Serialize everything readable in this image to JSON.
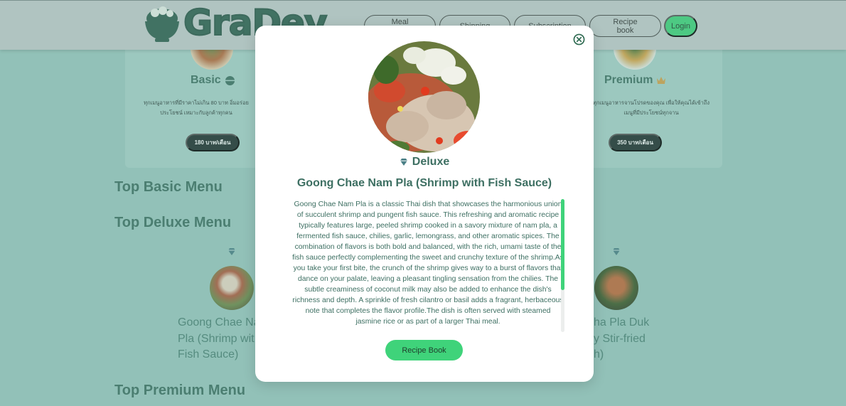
{
  "header": {
    "logo_text": "GraDey",
    "nav": [
      "Meal preparation",
      "Shipping",
      "Subscription",
      "Recipe book"
    ],
    "login_label": "Login"
  },
  "plans": {
    "basic": {
      "title": "Basic",
      "icon": "bowl-icon",
      "desc_line1": "ทุกเมนูอาหารที่มีราคาไม่เกิน 80 บาท อิ่มอร่อย",
      "desc_line2": "ประโยชน์ เหมาะกับลูกค้าทุกคน",
      "price": "180 บาท/เดือน"
    },
    "premium": {
      "title": "Premium",
      "icon": "crown-icon",
      "desc_line1": "ทุกเมนูอาหารจานโปรดของคุณ เพื่อให้คุณได้เข้าถึง",
      "desc_line2": "เมนูที่มีประโยชน์ทุกจาน",
      "price": "350 บาท/เดือน"
    }
  },
  "sections": {
    "basic": "Top Basic Menu",
    "deluxe": "Top Deluxe Menu",
    "premium": "Top Premium Menu"
  },
  "deluxe_items": {
    "left": {
      "line1": "Goong Chae Na",
      "line2": "Pla (Shrimp wit",
      "line3": "Fish Sauce)"
    },
    "right": {
      "line1": "ha Pla Duk",
      "line2": "y Stir-fried",
      "line3": "h)"
    }
  },
  "modal": {
    "tier": "Deluxe",
    "tier_icon": "diamond-icon",
    "title": "Goong Chae Nam Pla (Shrimp with Fish Sauce)",
    "description": "Goong Chae Nam Pla is a classic Thai dish that showcases the harmonious union of succulent shrimp and pungent fish sauce. This refreshing and aromatic recipe typically features large, peeled shrimp cooked in a savory mixture of nam pla, a fermented fish sauce, chilies, garlic, lemongrass, and other aromatic spices. The combination of flavors is both bold and balanced, with the rich, umami taste of the fish sauce perfectly complementing the sweet and crunchy texture of the shrimp.As you take your first bite, the crunch of the shrimp gives way to a burst of flavors that dance on your palate, leaving a pleasant tingling sensation from the chilies. The subtle creaminess of coconut milk may also be added to enhance the dish's richness and depth. A sprinkle of fresh cilantro or basil adds a fragrant, herbaceous note that completes the flavor profile.The dish is often served with steamed jasmine rice or as part of a larger Thai meal.",
    "recipe_button": "Recipe Book"
  },
  "colors": {
    "accent": "#3fd37a",
    "heading": "#3d6f62",
    "background": "#9bc9c0"
  }
}
